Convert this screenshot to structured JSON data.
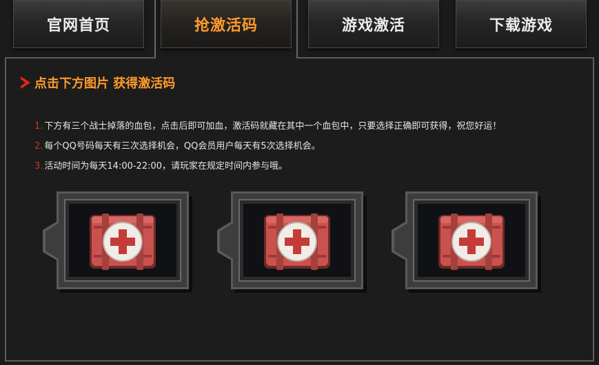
{
  "tabs": [
    {
      "label": "官网首页"
    },
    {
      "label": "抢激活码"
    },
    {
      "label": "游戏激活"
    },
    {
      "label": "下载游戏"
    }
  ],
  "active_tab": "抢激活码",
  "heading": "点击下方图片 获得激活码",
  "rules": [
    {
      "num": "1.",
      "text": "下方有三个战士掉落的血包，点击后即可加血，激活码就藏在其中一个血包中，只要选择正确即可获得，祝您好运！"
    },
    {
      "num": "2.",
      "text": "每个QQ号码每天有三次选择机会，QQ会员用户每天有5次选择机会。"
    },
    {
      "num": "3.",
      "text": "活动时间为每天14:00-22:00，请玩家在规定时间内参与哦。"
    }
  ],
  "cards": [
    {
      "icon": "medkit-icon"
    },
    {
      "icon": "medkit-icon"
    },
    {
      "icon": "medkit-icon"
    }
  ],
  "colors": {
    "accent_orange": "#ff9b2b",
    "rule_number_red": "#d4341f",
    "arrow_red": "#e3261c",
    "medkit_red": "#c9524f",
    "background": "#1b1b1b"
  }
}
